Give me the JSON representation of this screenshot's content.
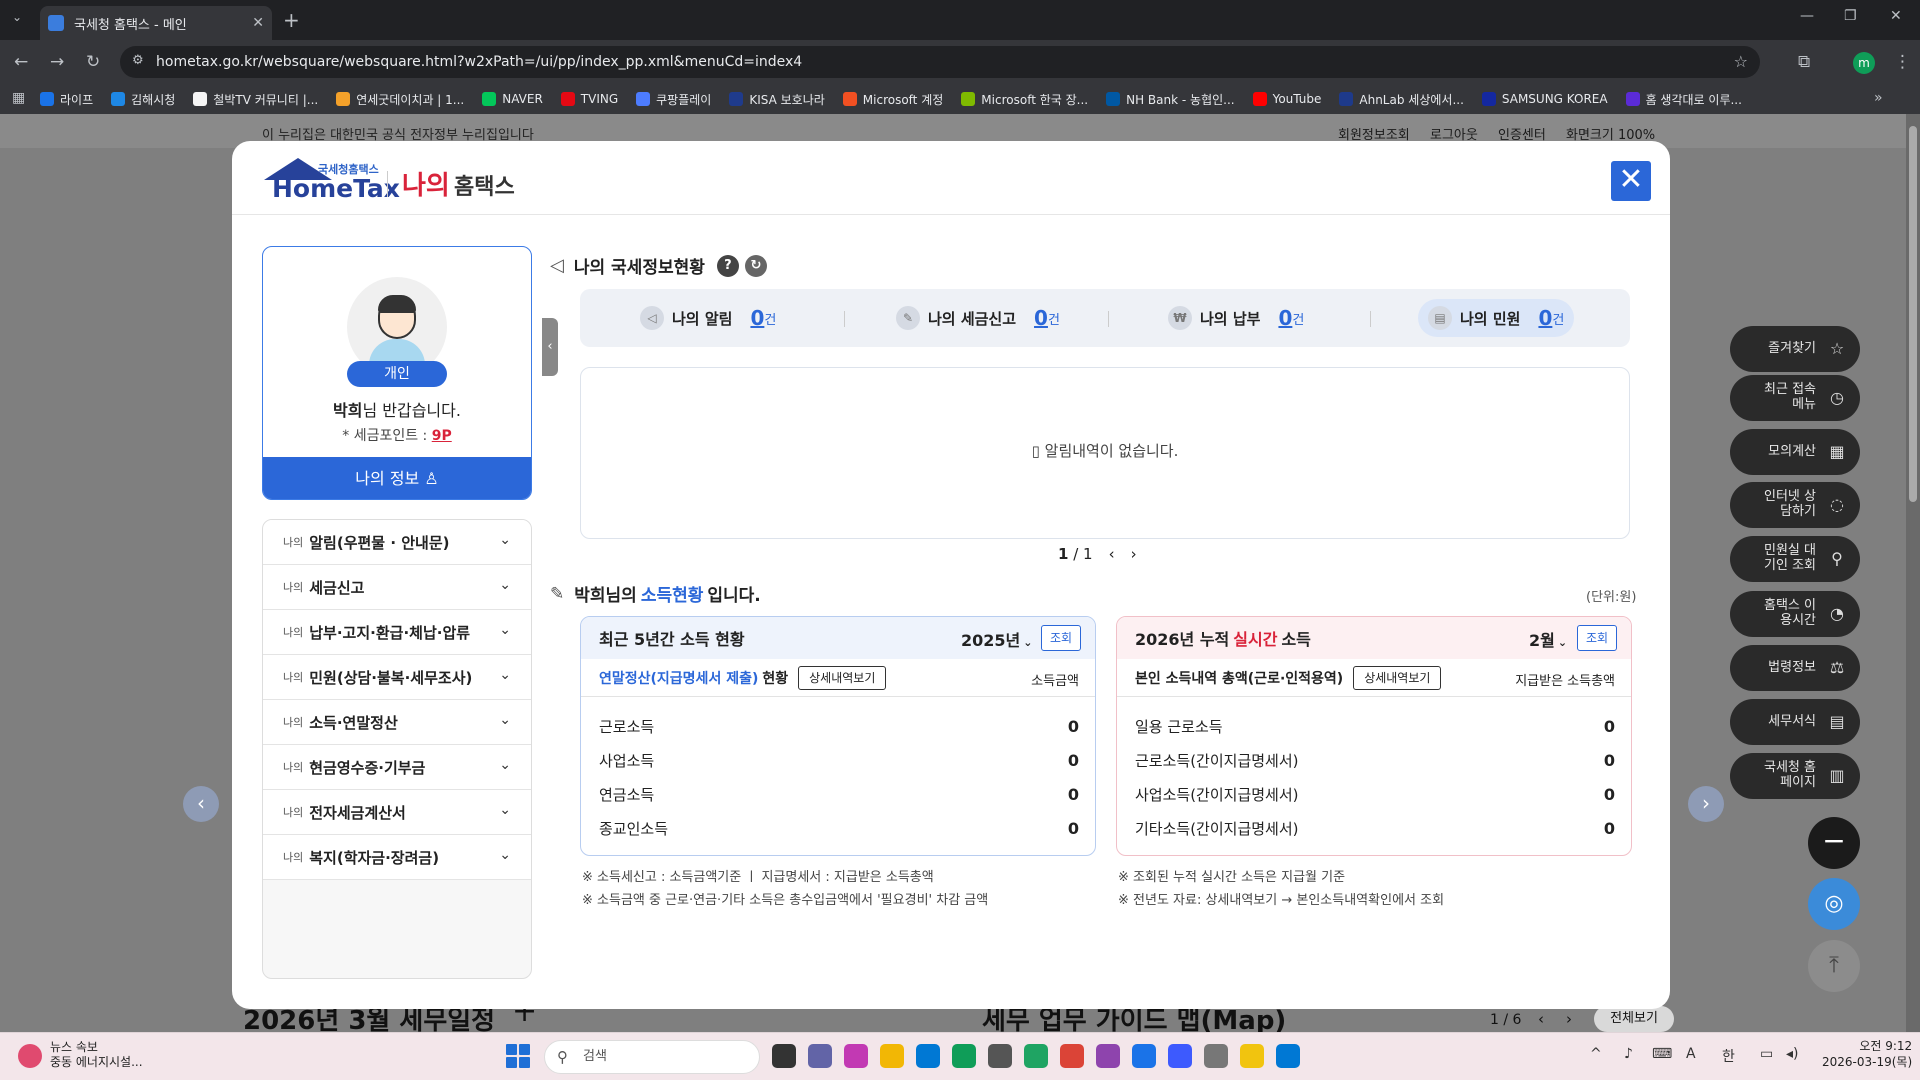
{
  "browser": {
    "tab_title": "국세청 홈택스 - 메인",
    "url": "hometax.go.kr/websquare/websquare.html?w2xPath=/ui/pp/index_pp.xml&menuCd=index4",
    "profile_letter": "m",
    "bookmarks": [
      {
        "label": "라이프",
        "color": "#1a73e8"
      },
      {
        "label": "김해시청",
        "color": "#1e88e5"
      },
      {
        "label": "철박TV 커뮤니티 |...",
        "color": "#f5f5f5"
      },
      {
        "label": "연세굿데이치과 | 1...",
        "color": "#f4a12a"
      },
      {
        "label": "NAVER",
        "color": "#03c75a"
      },
      {
        "label": "TVING",
        "color": "#e50914"
      },
      {
        "label": "쿠팡플레이",
        "color": "#4d7cfe"
      },
      {
        "label": "KISA 보호나라",
        "color": "#1f3b8c"
      },
      {
        "label": "Microsoft 계정",
        "color": "#f25022"
      },
      {
        "label": "Microsoft 한국 장...",
        "color": "#7fba00"
      },
      {
        "label": "NH Bank - 농협인...",
        "color": "#0058a3"
      },
      {
        "label": "YouTube",
        "color": "#ff0000"
      },
      {
        "label": "AhnLab 세상에서...",
        "color": "#1e3a8a"
      },
      {
        "label": "SAMSUNG KOREA",
        "color": "#1428a0"
      },
      {
        "label": "홈 생각대로 이루...",
        "color": "#5b2bd6"
      }
    ]
  },
  "background": {
    "gov_notice": "이 누리집은 대한민국 공식 전자정부 누리집입니다",
    "top_links": [
      "회원정보조회",
      "로그아웃",
      "인증센터",
      "화면크기 100%"
    ],
    "schedule_title": "2026년 3월 세무일정",
    "guide_title": "세무 업무 가이드 맵(Map)",
    "page_indicator": "1 / 6",
    "view_all": "전체보기"
  },
  "floating_menu": [
    {
      "label": "즐겨찾기",
      "icon": "star-icon",
      "glyph": "☆"
    },
    {
      "label": "최근 접속메뉴",
      "icon": "clock-icon",
      "glyph": "◷"
    },
    {
      "label": "모의계산",
      "icon": "calculator-icon",
      "glyph": "▦"
    },
    {
      "label": "인터넷 상담하기",
      "icon": "chat-icon",
      "glyph": "◌"
    },
    {
      "label": "민원실 대기인 조회",
      "icon": "person-search-icon",
      "glyph": "⚲"
    },
    {
      "label": "홈택스 이용시간",
      "icon": "timer-icon",
      "glyph": "◔"
    },
    {
      "label": "법령정보",
      "icon": "gavel-icon",
      "glyph": "⚖"
    },
    {
      "label": "세무서식",
      "icon": "form-icon",
      "glyph": "▤"
    },
    {
      "label": "국세청 홈페이지",
      "icon": "building-icon",
      "glyph": "▥"
    }
  ],
  "modal": {
    "logo_small": "국세청홈택스",
    "logo_main": "HomeTax",
    "title_my": "나의",
    "title_hometax": "홈택스",
    "profile": {
      "badge": "개인",
      "name": "박희",
      "greeting_suffix": "님 반갑습니다.",
      "points_label": "* 세금포인트 : ",
      "points_value": "9P",
      "my_info": "나의 정보"
    },
    "menu_prefix": "나의",
    "menu": [
      "알림(우편물 · 안내문)",
      "세금신고",
      "납부·고지·환급·체납·압류",
      "민원(상담·불복·세무조사)",
      "소득·연말정산",
      "현금영수증·기부금",
      "전자세금계산서",
      "복지(학자금·장려금)"
    ],
    "status": {
      "title": "나의 국세정보현황",
      "items": [
        {
          "label": "나의 알림",
          "count": "0",
          "unit": "건"
        },
        {
          "label": "나의 세금신고",
          "count": "0",
          "unit": "건"
        },
        {
          "label": "나의 납부",
          "count": "0",
          "unit": "건"
        },
        {
          "label": "나의 민원",
          "count": "0",
          "unit": "건"
        }
      ],
      "empty_notice": "알림내역이 없습니다.",
      "page_current": "1",
      "page_total": "/ 1"
    },
    "income": {
      "name": "박희",
      "title_mid": "님의",
      "title_hl": "소득현황",
      "title_end": "입니다.",
      "unit": "(단위:원)",
      "box1": {
        "title": "최근 5년간 소득 현황",
        "year": "2025년",
        "query": "조회",
        "sub_hl": "연말정산(지급명세서 제출)",
        "sub_end": "현황",
        "detail_btn": "상세내역보기",
        "right_head": "소득금액",
        "rows": [
          {
            "label": "근로소득",
            "value": "0"
          },
          {
            "label": "사업소득",
            "value": "0"
          },
          {
            "label": "연금소득",
            "value": "0"
          },
          {
            "label": "종교인소득",
            "value": "0"
          }
        ],
        "notes": [
          "※ 소득세신고 : 소득금액기준  ㅣ  지급명세서 : 지급받은 소득총액",
          "※ 소득금액 중 근로·연금·기타 소득은 총수입금액에서 '필요경비' 차감 금액"
        ]
      },
      "box2": {
        "title_pre": "2026년 누적",
        "title_red": "실시간",
        "title_end": "소득",
        "month": "2월",
        "query": "조회",
        "sub": "본인 소득내역 총액(근로·인적용역)",
        "detail_btn": "상세내역보기",
        "right_head": "지급받은 소득총액",
        "rows": [
          {
            "label": "일용 근로소득",
            "value": "0"
          },
          {
            "label": "근로소득(간이지급명세서)",
            "value": "0"
          },
          {
            "label": "사업소득(간이지급명세서)",
            "value": "0"
          },
          {
            "label": "기타소득(간이지급명세서)",
            "value": "0"
          }
        ],
        "notes": [
          "※ 조회된 누적 실시간 소득은 지급월 기준",
          "※ 전년도 자료: 상세내역보기 → 본인소득내역확인에서 조회"
        ]
      }
    }
  },
  "taskbar": {
    "news_title": "뉴스 속보",
    "news_sub": "중동 에너지시설...",
    "search_placeholder": "검색",
    "time": "오전 9:12",
    "date": "2026-03-19(목)",
    "lang": "한",
    "ime": "A"
  }
}
